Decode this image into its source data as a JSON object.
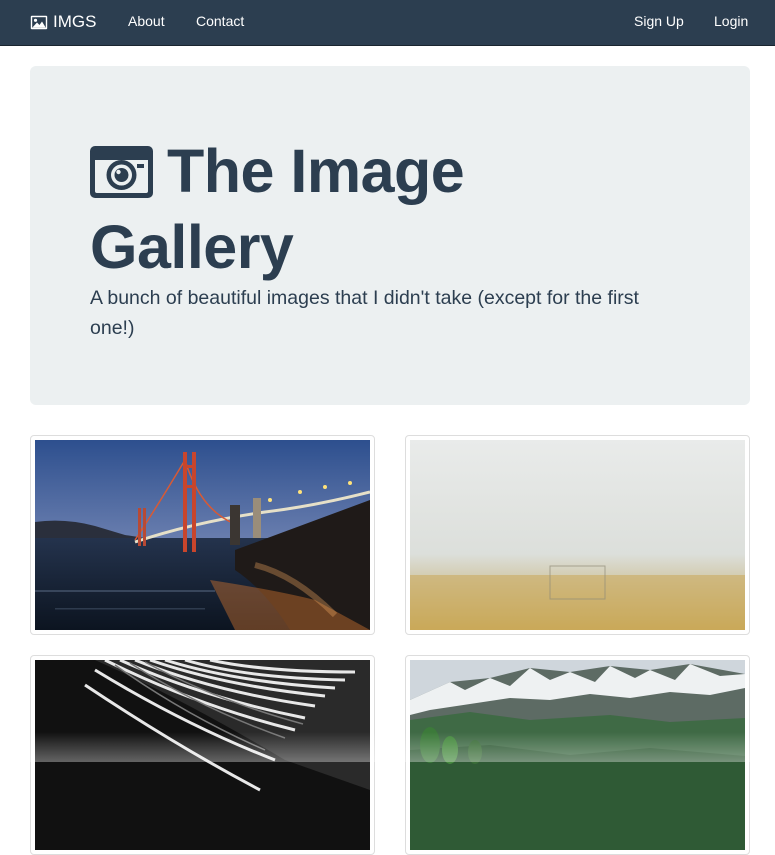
{
  "navbar": {
    "brand_icon": "image-icon",
    "brand_label": "IMGS",
    "links_left": [
      {
        "label": "About"
      },
      {
        "label": "Contact"
      }
    ],
    "links_right": [
      {
        "label": "Sign Up"
      },
      {
        "label": "Login"
      }
    ],
    "background_color": "#2c3e50"
  },
  "jumbotron": {
    "icon": "camera-icon",
    "title": "The Image Gallery",
    "lead": "A bunch of beautiful images that I didn't take (except for the first one!)",
    "background_color": "#ecf0f1",
    "text_color": "#2c3e50"
  },
  "gallery": {
    "images": [
      {
        "subject": "golden-gate-bridge-at-dusk"
      },
      {
        "subject": "foggy-field-with-goal"
      },
      {
        "subject": "black-and-white-architecture"
      },
      {
        "subject": "snowy-mountain-valley"
      }
    ]
  }
}
